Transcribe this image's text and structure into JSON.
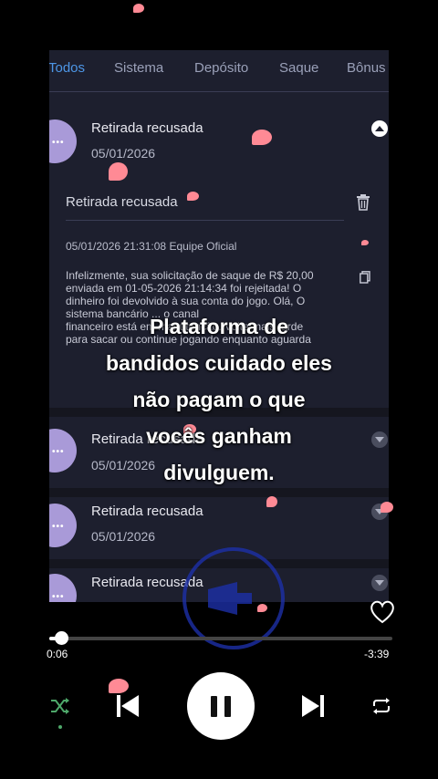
{
  "tabs": [
    "Todos",
    "Sistema",
    "Depósito",
    "Saque",
    "Bônus"
  ],
  "messages": [
    {
      "title": "Retirada recusada",
      "date": "05/01/2026"
    },
    {
      "title": "Retirada recusada",
      "date": "05/01/2026"
    },
    {
      "title": "Retirada recusada",
      "date": "05/01/2026"
    },
    {
      "title": "Retirada recusada",
      "date": ""
    }
  ],
  "detail": {
    "title": "Retirada recusada",
    "meta": "05/01/2026 21:31:08 Equipe Oficial",
    "body": "Infelizmente, sua solicitação de saque de R$ 20,00\nenviada em 01-05-2026 21:14:34 foi rejeitada! O\ndinheiro foi devolvido à sua conta do jogo. Olá, O\nsistema bancário ... o canal\nfinanceiro está em manutenção. Volte mais tarde\npara sacar ou continue jogando enquanto aguarda"
  },
  "overlay_text": "Plataforma de\nbandidos cuidado eles\nnão pagam o que\nvocês ganham\ndivulguem.",
  "player": {
    "elapsed": "0:06",
    "remaining": "-3:39",
    "progress": 0.02
  },
  "colors": {
    "accent": "#4d96e6",
    "avatar": "#a99ad8",
    "petal": "#ff8a95"
  }
}
